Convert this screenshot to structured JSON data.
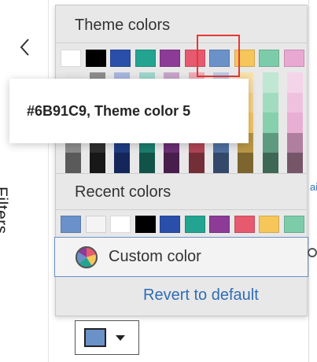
{
  "sidebar": {
    "label": "Filters",
    "collapse_icon": "chevron-left-icon"
  },
  "picker": {
    "theme_title": "Theme colors",
    "recent_title": "Recent colors",
    "custom_label": "Custom color",
    "revert_label": "Revert to default",
    "theme_colors": [
      "#FFFFFF",
      "#000000",
      "#2A4FAA",
      "#23A491",
      "#8C3B96",
      "#E6596F",
      "#6B91C9",
      "#F6C65A",
      "#7DCCA9",
      "#E9A8D2"
    ],
    "shade_rows": [
      [
        "#E6E6E6",
        "#8C8C8C",
        "#A8B5DD",
        "#9ED6CC",
        "#C7A3C9",
        "#F0AAB6",
        "#B6C9E4",
        "#F9E0A8",
        "#BFE7D3",
        "#F4D4E8"
      ],
      [
        "#D0D0D0",
        "#6E6E6E",
        "#7E92CC",
        "#6CC2B3",
        "#A97AAE",
        "#EA8496",
        "#93AFD8",
        "#F7D487",
        "#A2DCC0",
        "#EFC1DF"
      ],
      [
        "#BABABA",
        "#505050",
        "#5771BB",
        "#3FB09D",
        "#8F5693",
        "#E46078",
        "#7896CC",
        "#F5C767",
        "#86D0AD",
        "#E9AED4"
      ],
      [
        "#8C8C8C",
        "#2F2F2F",
        "#203C82",
        "#1B7C6E",
        "#6A2E72",
        "#AE4455",
        "#4E6F9E",
        "#BA9745",
        "#5E9A80",
        "#B07F9F"
      ],
      [
        "#5A5A5A",
        "#181818",
        "#15275A",
        "#125349",
        "#481F4C",
        "#742E38",
        "#34496A",
        "#7C652E",
        "#3F6755",
        "#765569"
      ]
    ],
    "recent_colors": [
      "#6B91C9",
      "#F4F4F4",
      "#FFFFFF",
      "#000000",
      "#2A4FAA",
      "#23A491",
      "#8C3B96",
      "#E6596F",
      "#F6C65A",
      "#7DCCA9"
    ],
    "selected_index": 6
  },
  "tooltip": {
    "text": "#6B91C9, Theme color 5"
  },
  "dropdown": {
    "current_color": "#6B91C9"
  },
  "background": {
    "partial_text": "ai"
  }
}
